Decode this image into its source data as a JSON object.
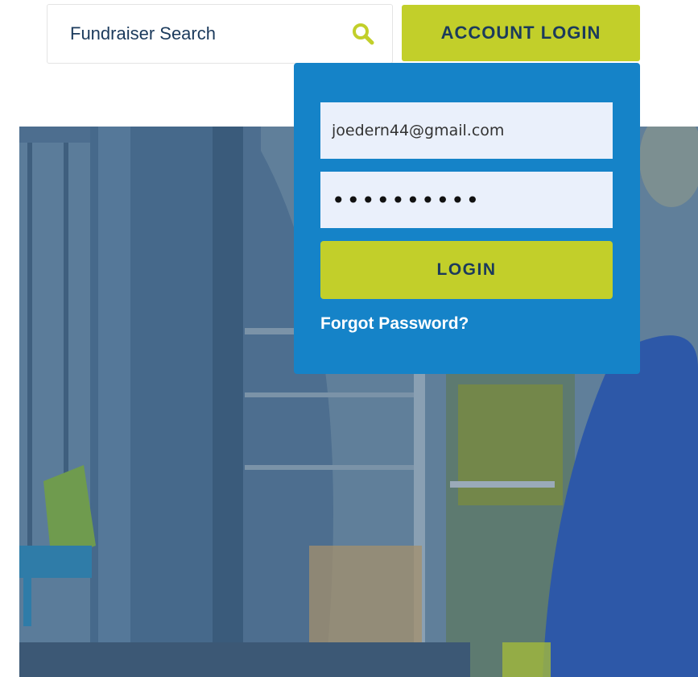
{
  "header": {
    "search": {
      "placeholder": "Fundraiser Search",
      "icon": "search-icon"
    },
    "account_login_label": "ACCOUNT LOGIN"
  },
  "login_panel": {
    "email_value": "joedern44@gmail.com",
    "password_masked": "••••••••••",
    "login_label": "LOGIN",
    "forgot_password_label": "Forgot Password?"
  },
  "colors": {
    "accent_green": "#c2cf2a",
    "panel_blue": "#1583c8",
    "navy_text": "#1b3a5c",
    "field_bg": "#eaf0fb"
  }
}
